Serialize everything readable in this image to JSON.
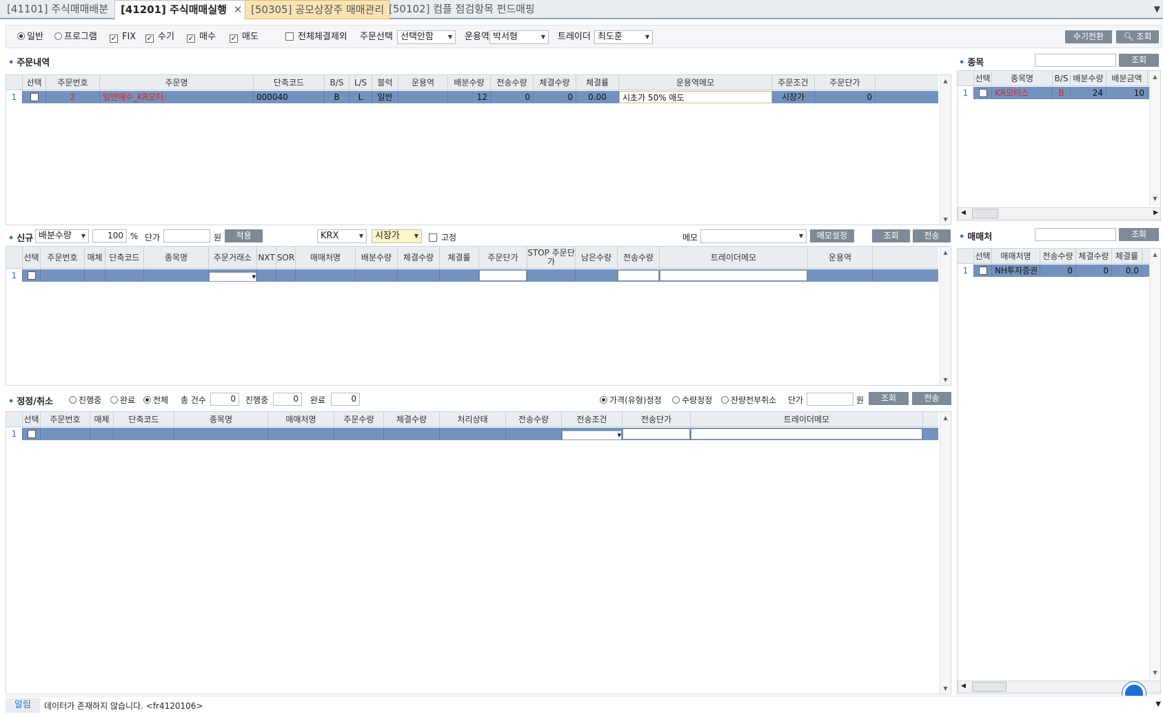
{
  "tabs": [
    {
      "label": "[41101] 주식매매배분"
    },
    {
      "label": "[41201] 주식매매실행",
      "close": "✕"
    },
    {
      "label": "[50305] 공모상장주 매매관리"
    },
    {
      "label": "[50102] 컴플 점검항목 펀드매핑"
    }
  ],
  "toolbar": {
    "radio_normal": "일반",
    "radio_program": "프로그램",
    "chk_fix": "FIX",
    "chk_manual": "수기",
    "chk_buy": "매수",
    "chk_sell": "매도",
    "chk_exclude": "전체체결제외",
    "order_select_label": "주문선택",
    "order_select_value": "선택안함",
    "manager_label": "운용역",
    "manager_value": "박서형",
    "trader_label": "트레이더",
    "trader_value": "최도훈",
    "switch_btn": "수기전환",
    "search_btn": "조회"
  },
  "orders": {
    "title": "주문내역",
    "columns": [
      "선택",
      "주문번호",
      "주문명",
      "단축코드",
      "B/S",
      "L/S",
      "블럭",
      "운용역",
      "배분수량",
      "전송수량",
      "체결수량",
      "체결률",
      "운용역메모",
      "주문조건",
      "주문단가"
    ],
    "row": {
      "num": "1",
      "order_no": "2",
      "order_name": "일반매수_KR모터:",
      "code": "000040",
      "bs": "B",
      "ls": "L",
      "block": "일반",
      "manager": "",
      "alloc": "12",
      "sent": "0",
      "filled": "0",
      "rate": "0.00",
      "memo": "시초가 50% 매도",
      "cond": "시장가",
      "price": "0"
    }
  },
  "stock_panel": {
    "title": "종목",
    "search_btn": "조회",
    "columns": [
      "선택",
      "종목명",
      "B/S",
      "배분수량",
      "배분금액"
    ],
    "row": {
      "num": "1",
      "name": "KR모터스",
      "bs": "B",
      "alloc": "24",
      "amount": "10"
    }
  },
  "new_order": {
    "title": "신규",
    "basis_value": "배분수량",
    "pct_value": "100",
    "pct_unit": "%",
    "price_label": "단가",
    "price_unit": "원",
    "apply_btn": "적용",
    "exchange_value": "KRX",
    "type_value": "시장가",
    "fixed_label": "고정",
    "memo_label": "메모",
    "memo_btn": "메모설정",
    "search_btn": "조회",
    "send_btn": "전송",
    "columns": [
      "선택",
      "주문번호",
      "매체",
      "단축코드",
      "종목명",
      "주문거래소",
      "NXT",
      "SOR",
      "매매처명",
      "배분수량",
      "체결수량",
      "체결률",
      "주문단가",
      "STOP 주문단가",
      "남은수량",
      "전송수량",
      "트레이더메모",
      "운용역"
    ],
    "row_num": "1"
  },
  "broker_panel": {
    "title": "매매처",
    "search_btn": "조회",
    "columns": [
      "선택",
      "매매처명",
      "전송수량",
      "체결수량",
      "체결률"
    ],
    "row": {
      "num": "1",
      "name": "NH투자증권",
      "sent": "0",
      "filled": "0",
      "rate": "0.0"
    }
  },
  "modify": {
    "title": "정정/취소",
    "r_progress": "진행중",
    "r_done": "완료",
    "r_all": "전체",
    "total_label": "총 건수",
    "total_value": "0",
    "prog_label": "진행중",
    "prog_value": "0",
    "done_label": "완료",
    "done_value": "0",
    "r_price": "가격(유형)정정",
    "r_qty": "수량정정",
    "r_cancel": "잔량전부취소",
    "price_label": "단가",
    "price_unit": "원",
    "search_btn": "조회",
    "send_btn": "전송",
    "columns": [
      "선택",
      "주문번호",
      "매체",
      "단축코드",
      "종목명",
      "매매처명",
      "주문수량",
      "체결수량",
      "처리상태",
      "전송수량",
      "전송조건",
      "전송단가",
      "트레이더메모"
    ],
    "row_num": "1"
  },
  "status": {
    "label": "알림",
    "message": "데이터가 존재하지 않습니다. <fr4120106>"
  },
  "colors": {
    "row": "#7392bd",
    "accent": "#2b73c6",
    "button": "#7d8a97",
    "red": "#e0201c"
  }
}
